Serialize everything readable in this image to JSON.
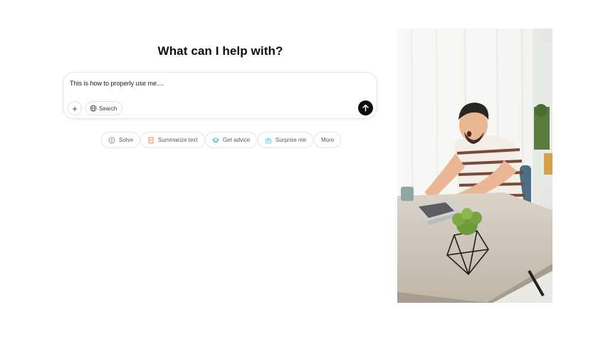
{
  "heading": "What can I help with?",
  "composer": {
    "prompt_text": "This is how to properly use me....",
    "plus_label": "+",
    "search_label": "Search"
  },
  "chips": [
    {
      "label": "Solve",
      "icon": "solve-icon",
      "color": "#c06ad8"
    },
    {
      "label": "Summarize text",
      "icon": "document-icon",
      "color": "#ea8444"
    },
    {
      "label": "Get advice",
      "icon": "graduation-cap-icon",
      "color": "#35b7c6"
    },
    {
      "label": "Surprise me",
      "icon": "gift-icon",
      "color": "#76d0eb"
    },
    {
      "label": "More",
      "icon": "",
      "color": ""
    }
  ],
  "colors": {
    "send_button": "#0d0d0d",
    "border": "#e5e5e5"
  }
}
